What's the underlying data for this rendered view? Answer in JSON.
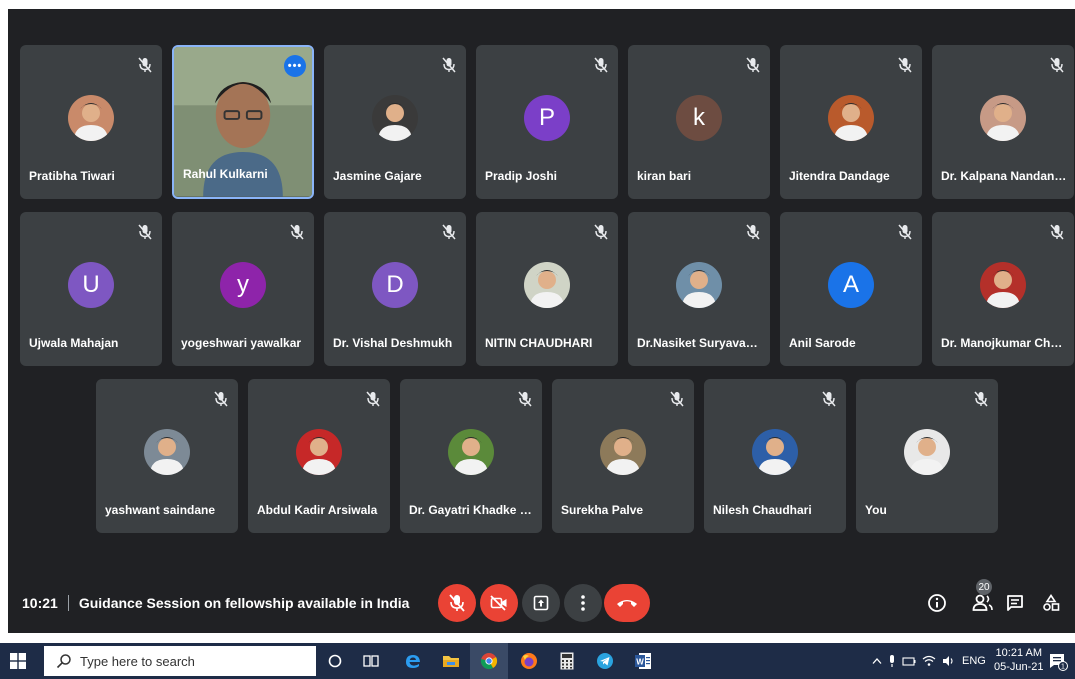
{
  "meeting": {
    "time": "10:21",
    "title": "Guidance Session on fellowship available in India",
    "participant_count": "20"
  },
  "participants": [
    {
      "name": "Pratibha Tiwari",
      "type": "photo",
      "color": "#c98a6a"
    },
    {
      "name": "Rahul Kulkarni",
      "type": "video",
      "color": "#8a9a7a"
    },
    {
      "name": "Jasmine Gajare",
      "type": "photo",
      "color": "#3a3a3a"
    },
    {
      "name": "Pradip Joshi",
      "type": "initial",
      "initial": "P",
      "color": "#7b3fc8"
    },
    {
      "name": "kiran bari",
      "type": "initial",
      "initial": "k",
      "color": "#6d4c41"
    },
    {
      "name": "Jitendra Dandage",
      "type": "photo",
      "color": "#b95a2c"
    },
    {
      "name": "Dr. Kalpana Nandanwar",
      "type": "photo",
      "color": "#c79a86"
    },
    {
      "name": "Ujwala Mahajan",
      "type": "initial",
      "initial": "U",
      "color": "#7e57c2"
    },
    {
      "name": "yogeshwari yawalkar",
      "type": "initial",
      "initial": "y",
      "color": "#8e24aa"
    },
    {
      "name": "Dr. Vishal Deshmukh",
      "type": "initial",
      "initial": "D",
      "color": "#7e57c2"
    },
    {
      "name": "NITIN CHAUDHARI",
      "type": "photo",
      "color": "#d0d4c6"
    },
    {
      "name": "Dr.Nasiket Suryavanshi",
      "type": "photo",
      "color": "#6f8fa8"
    },
    {
      "name": "Anil Sarode",
      "type": "initial",
      "initial": "A",
      "color": "#1a73e8"
    },
    {
      "name": "Dr. Manojkumar Chop...",
      "type": "photo",
      "color": "#b4302a"
    },
    {
      "name": "yashwant saindane",
      "type": "photo",
      "color": "#7d8a96"
    },
    {
      "name": "Abdul Kadir Arsiwala",
      "type": "photo",
      "color": "#c62828"
    },
    {
      "name": "Dr. Gayatri Khadke Patil",
      "type": "photo",
      "color": "#5b8a3a"
    },
    {
      "name": "Surekha Palve",
      "type": "photo",
      "color": "#8d7a5a"
    },
    {
      "name": "Nilesh Chaudhari",
      "type": "photo",
      "color": "#2d5fa8"
    },
    {
      "name": "You",
      "type": "photo",
      "color": "#e8e8e8"
    }
  ],
  "taskbar": {
    "search_placeholder": "Type here to search",
    "language": "ENG",
    "time": "10:21 AM",
    "date": "05-Jun-21",
    "notification_count": "1"
  },
  "colors": {
    "meeting_bg": "#202124",
    "tile_bg": "#3c4043",
    "red": "#ea4335",
    "taskbar": "#1e2c47",
    "accent": "#8ab4f8"
  }
}
